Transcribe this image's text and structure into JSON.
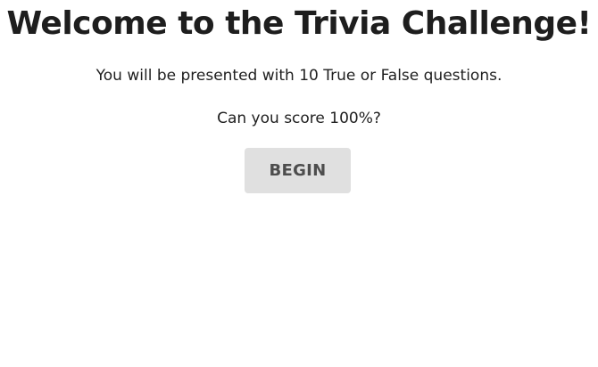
{
  "welcome": {
    "title": "Welcome to the Trivia Challenge!",
    "intro": "You will be presented with 10 True or False questions.",
    "prompt": "Can you score 100%?",
    "begin_label": "BEGIN"
  },
  "colors": {
    "background": "#ffffff",
    "text": "#1e1e1e",
    "button_bg": "#e0e0e0",
    "button_text": "#4d4d4d"
  }
}
